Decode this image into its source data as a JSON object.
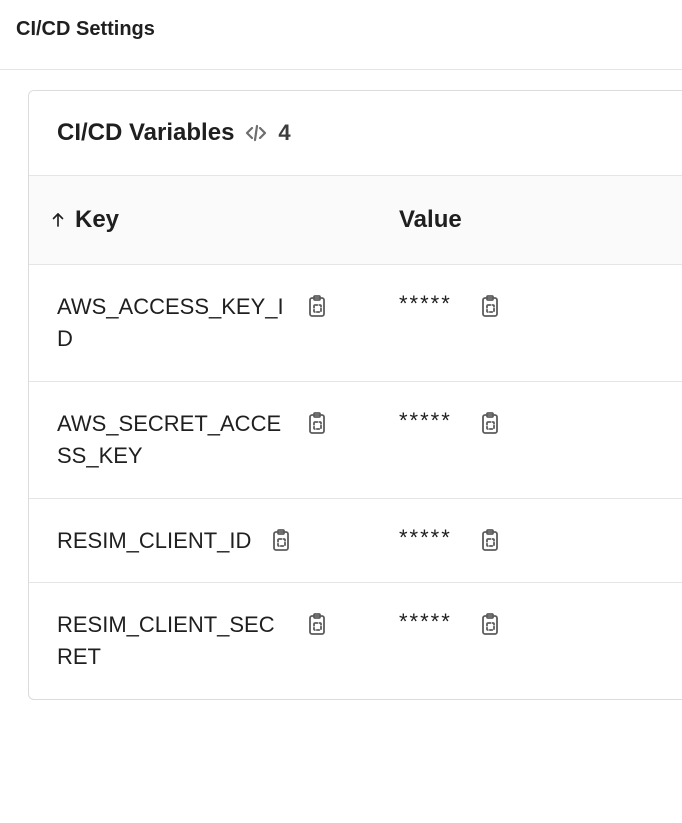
{
  "page": {
    "title": "CI/CD Settings"
  },
  "panel": {
    "title": "CI/CD Variables",
    "count": "4"
  },
  "table": {
    "head": {
      "key": "Key",
      "value": "Value"
    },
    "rows": [
      {
        "key": "AWS_ACCESS_KEY_ID",
        "value": "*****"
      },
      {
        "key": "AWS_SECRET_ACCESS_KEY",
        "value": "*****"
      },
      {
        "key": "RESIM_CLIENT_ID",
        "value": "*****"
      },
      {
        "key": "RESIM_CLIENT_SECRET",
        "value": "*****"
      }
    ]
  }
}
